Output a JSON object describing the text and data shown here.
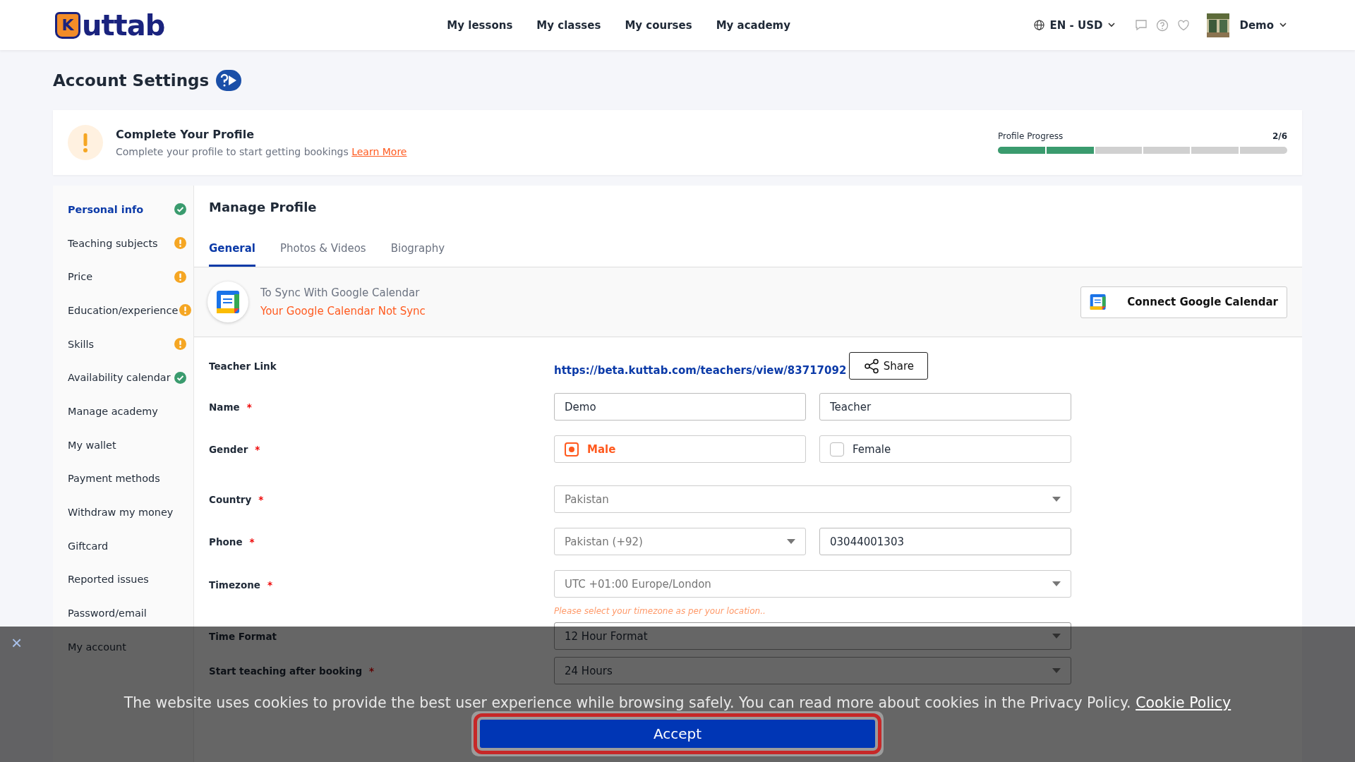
{
  "header": {
    "logo": {
      "mark": "K",
      "text": "uttab"
    },
    "nav": [
      "My lessons",
      "My classes",
      "My courses",
      "My academy"
    ],
    "locale": "EN - USD",
    "user": "Demo"
  },
  "page_title": "Account Settings",
  "profile_notice": {
    "title": "Complete Your Profile",
    "text": "Complete your profile to start getting bookings",
    "link": "Learn More",
    "progress_label": "Profile Progress",
    "progress_count": "2/6",
    "level": 0.3333
  },
  "sidebar": {
    "items": [
      {
        "label": "Personal info",
        "selected": true,
        "complete": true,
        "needs_attention": false
      },
      {
        "label": "Teaching subjects",
        "selected": false,
        "complete": false,
        "needs_attention": true
      },
      {
        "label": "Price",
        "selected": false,
        "complete": false,
        "needs_attention": true
      },
      {
        "label": "Education/experience",
        "selected": false,
        "complete": false,
        "needs_attention": true
      },
      {
        "label": "Skills",
        "selected": false,
        "complete": false,
        "needs_attention": true
      },
      {
        "label": "Availability calendar",
        "selected": false,
        "complete": true,
        "needs_attention": false
      },
      {
        "label": "Manage academy",
        "selected": false,
        "complete": false,
        "needs_attention": false
      },
      {
        "label": "My wallet",
        "selected": false,
        "complete": false,
        "needs_attention": false
      },
      {
        "label": "Payment methods",
        "selected": false,
        "complete": false,
        "needs_attention": false
      },
      {
        "label": "Withdraw my money",
        "selected": false,
        "complete": false,
        "needs_attention": false
      },
      {
        "label": "Giftcard",
        "selected": false,
        "complete": false,
        "needs_attention": false
      },
      {
        "label": "Reported issues",
        "selected": false,
        "complete": false,
        "needs_attention": false
      },
      {
        "label": "Password/email",
        "selected": false,
        "complete": false,
        "needs_attention": false
      },
      {
        "label": "My account",
        "selected": false,
        "complete": false,
        "needs_attention": false
      }
    ]
  },
  "content": {
    "title": "Manage Profile",
    "tabs": [
      {
        "label": "General",
        "selected": true
      },
      {
        "label": "Photos & Videos",
        "selected": false
      },
      {
        "label": "Biography",
        "selected": false
      }
    ],
    "calendar_sync": {
      "text": "To Sync With Google Calendar",
      "status": "Your Google Calendar Not Sync",
      "button": "Connect Google Calendar"
    },
    "form": [
      {
        "kind": "link",
        "label": "Teacher Link",
        "value": "https://beta.kuttab.com/teachers/view/83717092",
        "button": "Share"
      },
      {
        "kind": "pair",
        "label": "Name",
        "mark": "*",
        "values": [
          "Demo",
          "Teacher"
        ]
      },
      {
        "kind": "radio",
        "label": "Gender",
        "mark": "*",
        "options": [
          {
            "label": "Male",
            "selected": true
          },
          {
            "label": "Female",
            "selected": false
          }
        ]
      },
      {
        "kind": "select",
        "label": "Country",
        "mark": "*",
        "value": "Pakistan"
      },
      {
        "kind": "select_input",
        "label": "Phone",
        "mark": "*",
        "value": "Pakistan (+92)",
        "input": "03044001303"
      },
      {
        "kind": "select",
        "label": "Timezone",
        "mark": "*",
        "value": "UTC +01:00 Europe/London",
        "hint": "Please select your timezone as per your location.."
      },
      {
        "kind": "select",
        "label": "Time Format",
        "value": "12 Hour Format",
        "dark": true
      },
      {
        "kind": "select",
        "label": "Start teaching after booking",
        "mark": "*",
        "value": "24 Hours",
        "dark": true
      }
    ]
  },
  "cookie_banner": {
    "text": "The website uses cookies to provide the best user experience while browsing safely. You can read more about cookies in the Privacy Policy.",
    "link": "Cookie Policy",
    "button": "Accept",
    "close": "×"
  }
}
